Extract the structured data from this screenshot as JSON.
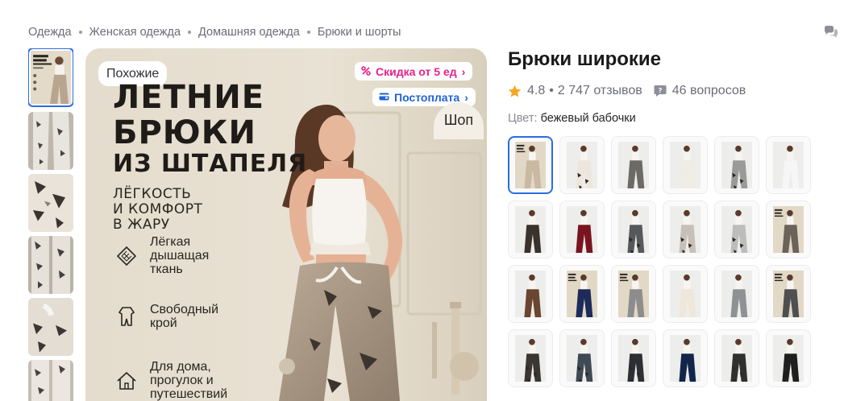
{
  "breadcrumb": {
    "items": [
      "Одежда",
      "Женская одежда",
      "Домашняя одежда",
      "Брюки и шорты"
    ]
  },
  "gallery": {
    "thumbnails": [
      {
        "name": "poster",
        "active": true
      },
      {
        "name": "butterfly-print"
      },
      {
        "name": "butterfly-print"
      },
      {
        "name": "butterfly-print"
      },
      {
        "name": "butterfly-print"
      },
      {
        "name": "butterfly-print"
      }
    ]
  },
  "main_image": {
    "similar_label": "Похожие",
    "discount_badge": "Скидка от 5 ед",
    "postpay_badge": "Постоплата",
    "shop_label": "Шоп",
    "poster_title_line1": "ЛЕТНИЕ",
    "poster_title_line2": "БРЮКИ",
    "poster_title_line3": "ИЗ ШТАПЕЛЯ",
    "poster_sub_line1": "ЛЁГКОСТЬ",
    "poster_sub_line2": "И КОМФОРТ",
    "poster_sub_line3": "В ЖАРУ",
    "features": [
      {
        "icon": "fabric-icon",
        "line1": "Лёгкая",
        "line2": "дышащая",
        "line3": "ткань"
      },
      {
        "icon": "pajama-icon",
        "line1": "Свободный",
        "line2": "крой",
        "line3": ""
      },
      {
        "icon": "home-icon",
        "line1": "Для дома,",
        "line2": "прогулок и",
        "line3": "путешествий"
      }
    ]
  },
  "product": {
    "title": "Брюки широкие",
    "rating": "4.8",
    "reviews": "2 747 отзывов",
    "questions": "46 вопросов",
    "color_label": "Цвет:",
    "color_value": "бежевый бабочки"
  },
  "colors": {
    "accent": "#2c6de0",
    "discount": "#e8218a",
    "postpay": "#1f63d6",
    "star": "#f5a623",
    "muted_text": "#6c6c7a"
  },
  "variants": [
    {
      "pants_color": "#c9b8a2",
      "pattern": "poster",
      "selected": true
    },
    {
      "pants_color": "#ece6dc",
      "pattern": "print"
    },
    {
      "pants_color": "#6d6a66",
      "pattern": "plain"
    },
    {
      "pants_color": "#f0ece4",
      "pattern": "plain"
    },
    {
      "pants_color": "#9a9a9a",
      "pattern": "print"
    },
    {
      "pants_color": "#f6f6f6",
      "pattern": "plain"
    },
    {
      "pants_color": "#3a332b",
      "pattern": "plain"
    },
    {
      "pants_color": "#7a1520",
      "pattern": "plain"
    },
    {
      "pants_color": "#55595c",
      "pattern": "print"
    },
    {
      "pants_color": "#c8c0b8",
      "pattern": "print"
    },
    {
      "pants_color": "#bdbdbd",
      "pattern": "print"
    },
    {
      "pants_color": "#6b6259",
      "pattern": "poster"
    },
    {
      "pants_color": "#6a4530",
      "pattern": "plain"
    },
    {
      "pants_color": "#1d2b5a",
      "pattern": "poster"
    },
    {
      "pants_color": "#8d8d8d",
      "pattern": "poster"
    },
    {
      "pants_color": "#eee7da",
      "pattern": "plain"
    },
    {
      "pants_color": "#8f9294",
      "pattern": "plain"
    },
    {
      "pants_color": "#4f4f52",
      "pattern": "poster"
    },
    {
      "pants_color": "#3b3631",
      "pattern": "print"
    },
    {
      "pants_color": "#404a55",
      "pattern": "print"
    },
    {
      "pants_color": "#2c2f33",
      "pattern": "print"
    },
    {
      "pants_color": "#13254a",
      "pattern": "plain"
    },
    {
      "pants_color": "#30302f",
      "pattern": "print"
    },
    {
      "pants_color": "#1f1f1f",
      "pattern": "print"
    }
  ]
}
